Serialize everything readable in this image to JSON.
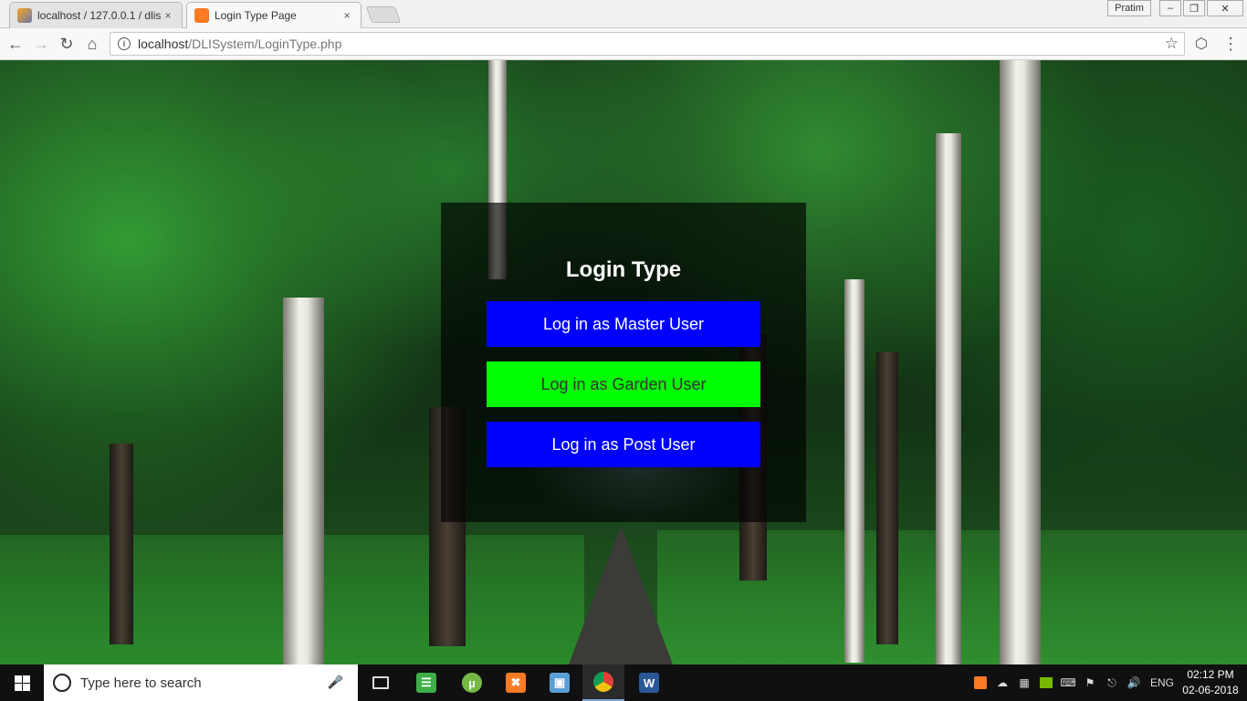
{
  "browser": {
    "tabs": [
      {
        "title": "localhost / 127.0.0.1 / dlis",
        "active": false
      },
      {
        "title": "Login Type Page",
        "active": true
      }
    ],
    "close_glyph": "×",
    "profile_name": "Pratim",
    "window_controls": [
      "‒",
      "❐",
      "✕"
    ],
    "url_host": "localhost",
    "url_path": "/DLISystem/LoginType.php"
  },
  "page": {
    "heading": "Login Type",
    "buttons": [
      {
        "label": "Log in as Master User",
        "color": "#0000ff",
        "text_color": "#ffffff"
      },
      {
        "label": "Log in as Garden User",
        "color": "#00ff00",
        "text_color": "#333333"
      },
      {
        "label": "Log in as Post User",
        "color": "#0000ff",
        "text_color": "#ffffff"
      }
    ]
  },
  "taskbar": {
    "search_placeholder": "Type here to search",
    "language": "ENG",
    "time": "02:12 PM",
    "date": "02-06-2018",
    "pinned_icons": [
      "task-view-icon",
      "notepad-icon",
      "utorrent-icon",
      "xampp-icon",
      "virtualbox-icon",
      "chrome-icon",
      "word-icon"
    ]
  }
}
